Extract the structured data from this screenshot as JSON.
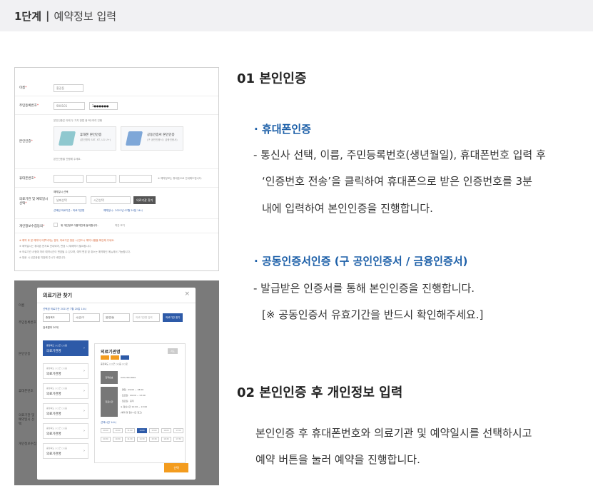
{
  "step": {
    "label": "1단계",
    "separator": "|",
    "title": "예약정보 입력"
  },
  "shot1": {
    "name_label": "이름",
    "name_value": "홍길동",
    "rrn_label": "주민등록번호",
    "rrn_front": "900101",
    "rrn_back": "1●●●●●●",
    "auth_label": "본인인증",
    "auth_hint": "본인인증은 아래 두 가지 방법 중 택1하여 진행",
    "card1_title": "휴대폰 본인인증",
    "card1_sub": "(본인명의 SKT, KT, LG U+)",
    "card2_title": "공동인증서 본인인증",
    "card2_sub": "(구 공인인증서 / 금융인증서)",
    "auth_note": "본인인증을 진행해 주세요.",
    "phone_label": "휴대폰번호",
    "phone_note": "※ 예약정보는 휴대폰으로 안내해드립니다.",
    "hosp_label": "의료기관 및 예약일시 선택",
    "date_label": "예약일시 선택",
    "date_placeholder": "날짜선택",
    "time_placeholder": "시간선택",
    "find_button": "의료기관 찾기",
    "sel_info": "선택된 의료기관 : 의료기관명",
    "sel_date": "예약일시 : 2021년 07월 20일 14시",
    "privacy_label": "개인정보수집동의",
    "privacy_text": "위 개인정보 이용약관에 동의합니다.",
    "privacy_link": "약관 보기",
    "warn1": "※ 예약 후 본 예약이 이루어지는 경우, 의료기관 방문 시 반드시 예약 내용을 확인해 주세요.",
    "note2": "※ 예약일시는 휴대폰 문자로 안내되며, 변경 시 재예약이 필요합니다.",
    "note3": "※ 의료기관 사정에 따라 예약시간이 변경될 수 있으며, 예약 변경 및 취소는 예약확인 메뉴에서 가능합니다.",
    "note4": "※ 방문 시 신분증을 지참해 주시기 바랍니다."
  },
  "shot2": {
    "title": "의료기관 찾기",
    "close": "×",
    "selected_note": "선택된 의료기관 2021년 7월 20일 14시",
    "sel1": "충청북도",
    "sel2": "시/군/구",
    "sel3": "읍/면/동",
    "search_placeholder": "의료기관명 입력",
    "search_button": "의료기관 찾기",
    "result_count": "검색결과 20개",
    "items": [
      {
        "addr": "충청북도 ○○군 ○○읍",
        "name": "의료기관명"
      },
      {
        "addr": "충청북도 ○○군 ○○읍",
        "name": "의료기관명"
      },
      {
        "addr": "충청북도 ○○군 ○○읍",
        "name": "의료기관명"
      },
      {
        "addr": "충청북도 ○○군 ○○읍",
        "name": "의료기관명"
      },
      {
        "addr": "충청북도 ○○군 ○○읍",
        "name": "의료기관명"
      },
      {
        "addr": "충청북도 ○○군 ○○읍",
        "name": "의료기관명"
      }
    ],
    "detail_name": "의료기관명",
    "detail_btn": "지도",
    "detail_addr": "충청북도 ○○군 ○○읍 ○○로",
    "detail_tel_label": "전화번호",
    "detail_tel": "043-200-0000",
    "detail_hours_label": "진료시간",
    "detail_lines": [
      "· 평일 : 09:00 ~ 18:00",
      "· 토요일 : 09:00 ~ 13:00",
      "· 일요일 : 휴무",
      "※ 점심시간 12:00 ~ 13:00",
      "(예약 및 접수시간 참고)"
    ],
    "time_label": "선택시간 14시",
    "slots": [
      "09:00",
      "10:00",
      "11:00",
      "14:00",
      "15:00",
      "16:00",
      "17:00",
      "09:30",
      "10:30",
      "11:30",
      "14:30",
      "15:30",
      "16:30",
      "17:30"
    ],
    "confirm": "선택",
    "bg_labels": [
      "이름",
      "주민등록번호",
      "본인인증",
      "휴대폰번호",
      "의료기관 및 예약일시 선택",
      "개인정보수집"
    ]
  },
  "section1": {
    "title": "01 본인인증",
    "bullet1": "휴대폰인증",
    "lines1": [
      "- 통신사 선택, 이름, 주민등록번호(생년월일), 휴대폰번호 입력 후",
      "‘인증번호 전송’을 클릭하여 휴대폰으로 받은 인증번호를 3분",
      "내에 입력하여 본인인증을 진행합니다."
    ],
    "bullet2": "공동인증서인증 (구 공인인증서 / 금융인증서)",
    "lines2": [
      "- 발급받은 인증서를 통해 본인인증을 진행합니다.",
      "[※ 공동인증서 유효기간을 반드시 확인해주세요.]"
    ]
  },
  "section2": {
    "title": "02 본인인증 후 개인정보 입력",
    "lines": [
      "본인인증 후 휴대폰번호와 의료기관 및 예약일시를 선택하시고",
      "예약 버튼을 눌러 예약을 진행합니다."
    ]
  },
  "colors": {
    "accent": "#1c5fa8",
    "orange": "#f39c1f",
    "stepbar": "#f1f1f3"
  }
}
